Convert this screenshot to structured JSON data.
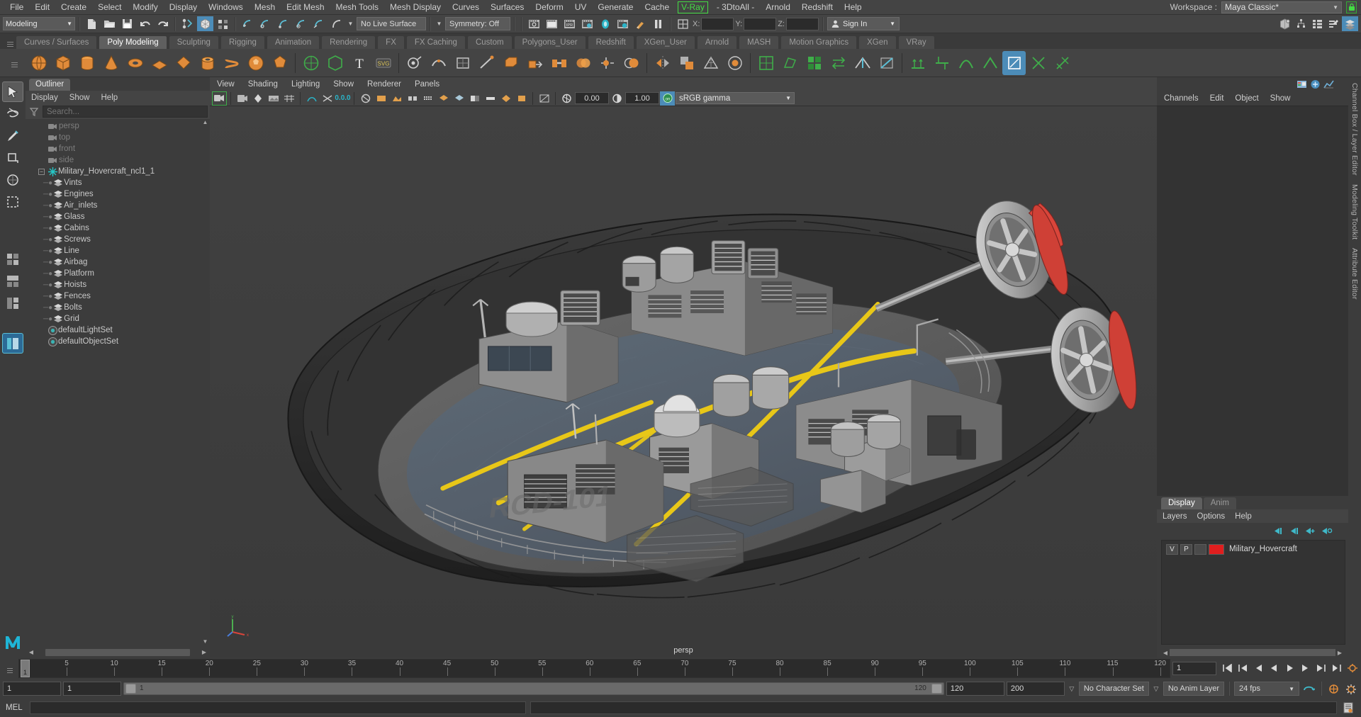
{
  "app": {
    "menus": [
      "File",
      "Edit",
      "Create",
      "Select",
      "Modify",
      "Display",
      "Windows",
      "Mesh",
      "Edit Mesh",
      "Mesh Tools",
      "Mesh Display",
      "Curves",
      "Surfaces",
      "Deform",
      "UV",
      "Generate",
      "Cache"
    ],
    "menu_vray": "V-Ray",
    "menus_after": [
      "- 3DtoAll -",
      "Arnold",
      "Redshift",
      "Help"
    ],
    "workspace_label": "Workspace :",
    "workspace_value": "Maya Classic*"
  },
  "status_line": {
    "mode": "Modeling",
    "live_surface": "No Live Surface",
    "symmetry": "Symmetry: Off",
    "coord_x_label": "X:",
    "coord_y_label": "Y:",
    "coord_z_label": "Z:",
    "coord_x": "",
    "coord_y": "",
    "coord_z": "",
    "sign_in": "Sign In",
    "snap_badge": "0.0.0"
  },
  "shelf": {
    "tabs": [
      "Curves / Surfaces",
      "Poly Modeling",
      "Sculpting",
      "Rigging",
      "Animation",
      "Rendering",
      "FX",
      "FX Caching",
      "Custom",
      "Polygons_User",
      "Redshift",
      "XGen_User",
      "Arnold",
      "MASH",
      "Motion Graphics",
      "XGen",
      "VRay"
    ],
    "active_tab": "Poly Modeling"
  },
  "outliner": {
    "tab": "Outliner",
    "menus": [
      "Display",
      "Show",
      "Help"
    ],
    "search_placeholder": "Search...",
    "cameras": [
      "persp",
      "top",
      "front",
      "side"
    ],
    "root": "Military_Hovercraft_ncl1_1",
    "children": [
      "Vints",
      "Engines",
      "Air_inlets",
      "Glass",
      "Cabins",
      "Screws",
      "Line",
      "Airbag",
      "Platform",
      "Hoists",
      "Fences",
      "Bolts",
      "Grid"
    ],
    "sets": [
      "defaultLightSet",
      "defaultObjectSet"
    ]
  },
  "viewport": {
    "menus": [
      "View",
      "Shading",
      "Lighting",
      "Show",
      "Renderer",
      "Panels"
    ],
    "exposure": "0.00",
    "gamma_value": "1.00",
    "color_profile": "sRGB gamma",
    "camera_label": "persp"
  },
  "right_panel": {
    "menus": [
      "Channels",
      "Edit",
      "Object",
      "Show"
    ],
    "layer_tabs": [
      "Display",
      "Anim"
    ],
    "layer_tab_active": "Display",
    "layer_menus": [
      "Layers",
      "Options",
      "Help"
    ],
    "layers": [
      {
        "visible": "V",
        "playback": "P",
        "color": "#e01e1e",
        "name": "Military_Hovercraft"
      }
    ]
  },
  "vertical_tabs": [
    "Channel Box / Layer Editor",
    "Modeling Toolkit",
    "Attribute Editor"
  ],
  "timeline": {
    "current_frame": "1",
    "ticks": [
      5,
      10,
      15,
      20,
      25,
      30,
      35,
      40,
      45,
      50,
      55,
      60,
      65,
      70,
      75,
      80,
      85,
      90,
      95,
      100,
      105,
      110,
      115,
      120
    ],
    "range_start": "1",
    "range_end": "120",
    "goto_frame": "1"
  },
  "range_slider": {
    "anim_start": "1",
    "range_start": "1",
    "bar_start": "1",
    "bar_end": "120",
    "range_end": "120",
    "anim_end": "200",
    "character_set": "No Character Set",
    "anim_layer": "No Anim Layer",
    "fps": "24 fps"
  },
  "command_line": {
    "label": "MEL",
    "input_value": "",
    "output_value": ""
  },
  "colors": {
    "accent": "#4c8cb8",
    "vray_green": "#44dd44",
    "panel_bg": "#3c3c3c",
    "toolbar_bg": "#444444",
    "field_bg": "#2b2b2b",
    "layer_red": "#e01e1e"
  }
}
